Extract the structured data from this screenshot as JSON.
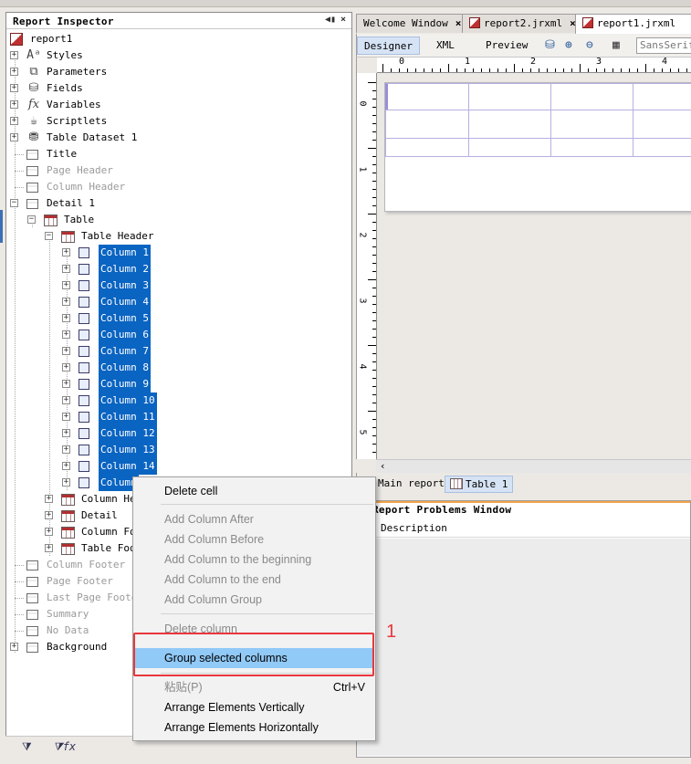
{
  "left_panel": {
    "title": "Report Inspector",
    "tree": [
      {
        "label": "report1",
        "icon": "report-icon"
      },
      {
        "label": "Styles",
        "icon": "styles-icon"
      },
      {
        "label": "Parameters",
        "icon": "parameters-icon"
      },
      {
        "label": "Fields",
        "icon": "database-icon"
      },
      {
        "label": "Variables",
        "icon": "fx-icon",
        "glyph": "fx"
      },
      {
        "label": "Scriptlets",
        "icon": "coffee-icon",
        "glyph": "☕"
      },
      {
        "label": "Table Dataset 1",
        "icon": "dataset-icon"
      },
      {
        "label": "Title",
        "icon": "band-icon"
      },
      {
        "label": "Page Header",
        "icon": "band-icon"
      },
      {
        "label": "Column Header",
        "icon": "band-icon"
      },
      {
        "label": "Detail 1",
        "icon": "band-icon"
      },
      {
        "label": "Table",
        "icon": "table-icon"
      },
      {
        "label": "Table Header",
        "icon": "table-icon"
      },
      {
        "label": "Column 1",
        "icon": "column-icon"
      },
      {
        "label": "Column 2",
        "icon": "column-icon"
      },
      {
        "label": "Column 3",
        "icon": "column-icon"
      },
      {
        "label": "Column 4",
        "icon": "column-icon"
      },
      {
        "label": "Column 5",
        "icon": "column-icon"
      },
      {
        "label": "Column 6",
        "icon": "column-icon"
      },
      {
        "label": "Column 7",
        "icon": "column-icon"
      },
      {
        "label": "Column 8",
        "icon": "column-icon"
      },
      {
        "label": "Column 9",
        "icon": "column-icon"
      },
      {
        "label": "Column 10",
        "icon": "column-icon"
      },
      {
        "label": "Column 11",
        "icon": "column-icon"
      },
      {
        "label": "Column 12",
        "icon": "column-icon"
      },
      {
        "label": "Column 13",
        "icon": "column-icon"
      },
      {
        "label": "Column 14",
        "icon": "column-icon"
      },
      {
        "label": "Column",
        "icon": "column-icon"
      },
      {
        "label": "Column Hea",
        "icon": "table-icon"
      },
      {
        "label": "Detail",
        "icon": "table-icon"
      },
      {
        "label": "Column Foo",
        "icon": "table-icon"
      },
      {
        "label": "Table Foot",
        "icon": "table-icon"
      },
      {
        "label": "Column Footer",
        "icon": "band-icon"
      },
      {
        "label": "Page Footer",
        "icon": "band-icon"
      },
      {
        "label": "Last Page Footer",
        "icon": "band-icon"
      },
      {
        "label": "Summary",
        "icon": "band-icon"
      },
      {
        "label": "No Data",
        "icon": "band-icon"
      },
      {
        "label": "Background",
        "icon": "band-icon"
      }
    ],
    "bottom_icons": [
      "filter-icon",
      "fx-filter-icon"
    ]
  },
  "tabs": [
    {
      "label": "Welcome Window",
      "close": "×"
    },
    {
      "label": "report2.jrxml",
      "close": "×"
    },
    {
      "label": "report1.jrxml",
      "close": "×"
    }
  ],
  "editor_toolbar": {
    "modes": [
      "Designer",
      "XML",
      "Preview"
    ],
    "font_value": "SansSerif",
    "icons": [
      "database-icon",
      "zoom-in-icon",
      "zoom-out-icon",
      "properties-icon"
    ]
  },
  "ruler": {
    "h_numbers": [
      "0",
      "1",
      "2",
      "3",
      "4"
    ],
    "v_numbers": [
      "0",
      "1",
      "2",
      "3",
      "4",
      "5"
    ]
  },
  "design_tabs": [
    "Main report",
    "Table 1"
  ],
  "problems": {
    "title": "Report Problems Window",
    "column_header": "Description"
  },
  "context_menu": {
    "items": [
      {
        "label": "Delete cell",
        "enabled": true
      },
      {
        "label": "Add Column After",
        "enabled": false
      },
      {
        "label": "Add Column Before",
        "enabled": false
      },
      {
        "label": "Add Column to the beginning",
        "enabled": false
      },
      {
        "label": "Add Column to the end",
        "enabled": false
      },
      {
        "label": "Add Column Group",
        "enabled": false
      },
      {
        "label": "Delete column",
        "enabled": false
      },
      {
        "label": "Group selected columns",
        "enabled": true,
        "highlighted": true
      },
      {
        "label": "粘贴(P)",
        "enabled": false,
        "shortcut": "Ctrl+V"
      },
      {
        "label": "Arrange Elements Vertically",
        "enabled": true
      },
      {
        "label": "Arrange Elements Horizontally",
        "enabled": true
      }
    ]
  },
  "annotation": {
    "number": "1",
    "color": "#e8383d"
  },
  "colors": {
    "selection": "#0a64c2",
    "menu_highlight": "#91c9f7",
    "accent_orange": "#f3a24a"
  }
}
